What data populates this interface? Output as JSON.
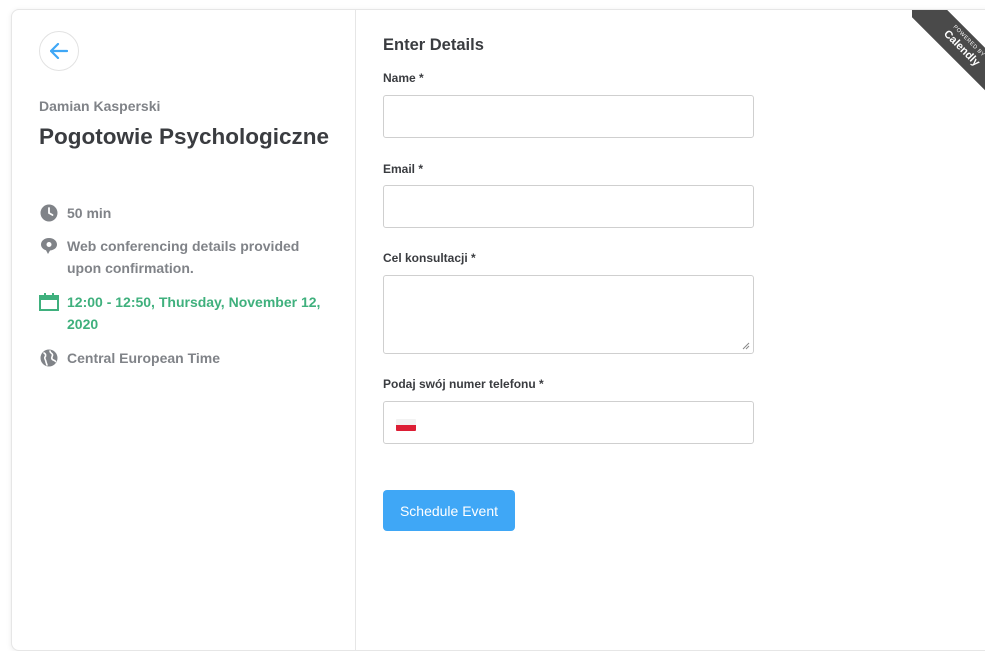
{
  "event": {
    "organizer": "Damian Kasperski",
    "title": "Pogotowie Psychologiczne",
    "duration": "50 min",
    "conferencing": "Web conferencing details provided upon confirmation.",
    "datetime": "12:00 - 12:50, Thursday, November 12, 2020",
    "timezone": "Central European Time"
  },
  "form": {
    "title": "Enter Details",
    "name_label": "Name *",
    "name_value": "",
    "email_label": "Email *",
    "email_value": "",
    "purpose_label": "Cel konsultacji *",
    "purpose_value": "",
    "phone_label": "Podaj swój numer telefonu *",
    "phone_value": "",
    "phone_country_flag": "PL",
    "submit_label": "Schedule Event"
  },
  "badge": {
    "powered": "POWERED BY",
    "brand": "Calendly"
  },
  "colors": {
    "accent_blue": "#3fa7f6",
    "green": "#3fb07d",
    "icon_gray": "#808388",
    "ribbon": "#4a4a4a"
  },
  "icons": {
    "back": "arrow-left-icon",
    "duration": "clock-icon",
    "conferencing": "chat-bubble-icon",
    "datetime": "calendar-icon",
    "timezone": "globe-icon"
  }
}
